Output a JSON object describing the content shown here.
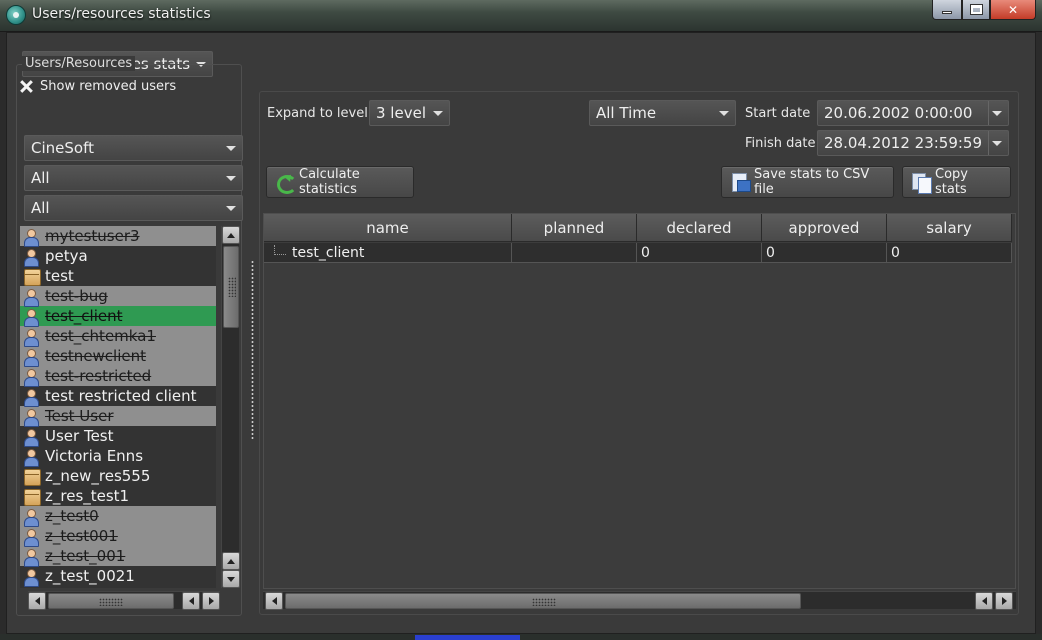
{
  "window": {
    "title": "Users/resources statistics",
    "minimize_label": "",
    "maximize_label": "",
    "close_label": "✕"
  },
  "mode_select": {
    "value": "Users/resources stats"
  },
  "left_panel": {
    "group_title": "Users/Resources",
    "show_removed": {
      "label": "Show removed users",
      "checked": true
    },
    "filters": [
      {
        "value": "CineSoft"
      },
      {
        "value": "All"
      },
      {
        "value": "All"
      }
    ],
    "items": [
      {
        "label": "mytestuser3",
        "icon": "user-icon",
        "state": "removed"
      },
      {
        "label": "petya",
        "icon": "user-icon",
        "state": "normal"
      },
      {
        "label": "test",
        "icon": "resource-icon",
        "state": "normal"
      },
      {
        "label": "test-bug",
        "icon": "user-icon",
        "state": "removed"
      },
      {
        "label": "test_client",
        "icon": "user-icon",
        "state": "selected"
      },
      {
        "label": "test_chtemka1",
        "icon": "user-icon",
        "state": "removed"
      },
      {
        "label": "testnewclient",
        "icon": "user-icon",
        "state": "removed"
      },
      {
        "label": "test-restricted",
        "icon": "user-icon",
        "state": "removed"
      },
      {
        "label": "test restricted client",
        "icon": "user-icon",
        "state": "normal"
      },
      {
        "label": "Test User",
        "icon": "user-icon",
        "state": "removed"
      },
      {
        "label": "User Test",
        "icon": "user-icon",
        "state": "normal"
      },
      {
        "label": "Victoria Enns",
        "icon": "user-icon",
        "state": "normal"
      },
      {
        "label": "z_new_res555",
        "icon": "resource-icon",
        "state": "normal"
      },
      {
        "label": "z_res_test1",
        "icon": "resource-icon",
        "state": "normal"
      },
      {
        "label": "z_test0",
        "icon": "user-icon",
        "state": "removed"
      },
      {
        "label": "z_test001",
        "icon": "user-icon",
        "state": "removed"
      },
      {
        "label": "z_test_001",
        "icon": "user-icon",
        "state": "removed"
      },
      {
        "label": "z_test_0021",
        "icon": "user-icon",
        "state": "normal"
      }
    ]
  },
  "toolbar": {
    "expand_label": "Expand to level",
    "expand_value": "3 level",
    "period_value": "All Time",
    "start_label": "Start date",
    "start_value": "20.06.2002 0:00:00",
    "finish_label": "Finish date",
    "finish_value": "28.04.2012 23:59:59",
    "calculate_label": "Calculate statistics",
    "save_csv_label": "Save stats to CSV file",
    "copy_label": "Copy stats"
  },
  "grid": {
    "columns": [
      "name",
      "planned",
      "declared",
      "approved",
      "salary"
    ],
    "rows": [
      {
        "name": "test_client",
        "planned": "",
        "declared": "0",
        "approved": "0",
        "salary": "0"
      }
    ]
  },
  "colors": {
    "selected_row": "#2f9a52",
    "removed_row": "#8f8f8f",
    "background": "#3a3a3a"
  }
}
